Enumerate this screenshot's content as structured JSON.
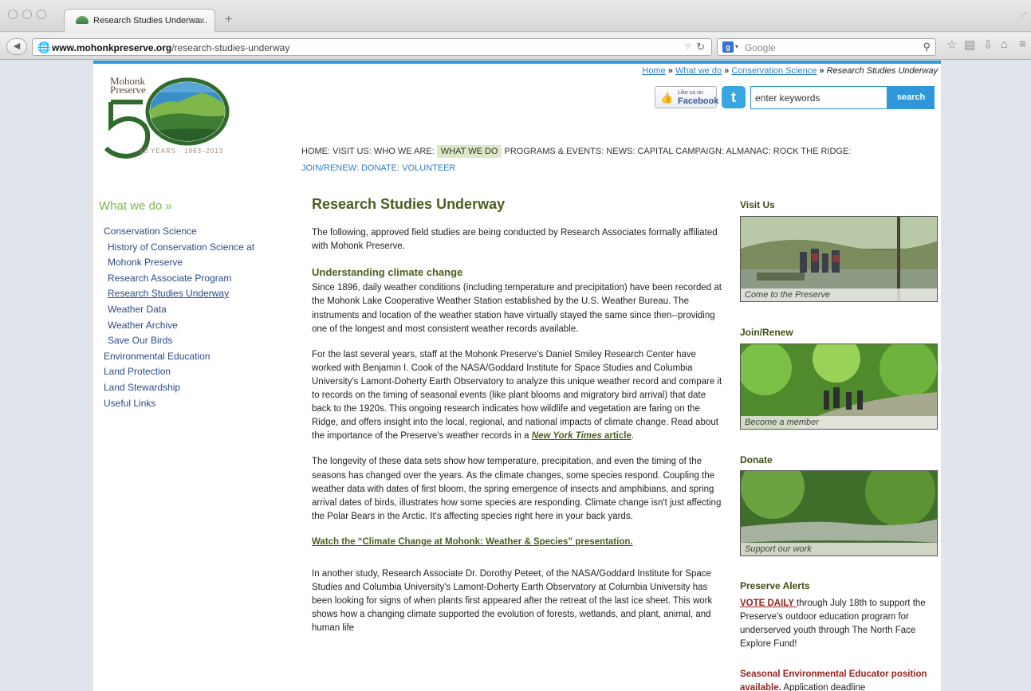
{
  "browser": {
    "tab_title": "Research Studies Underwa...",
    "url_domain": "www.mohonkpreserve.org",
    "url_path": "/research-studies-underway",
    "search_engine": "Google"
  },
  "header": {
    "breadcrumb": {
      "home": "Home",
      "what_we_do": "What we do",
      "conservation_science": "Conservation Science",
      "current": "Research Studies Underway",
      "separator": "»"
    },
    "logo": {
      "name_line1": "Mohonk",
      "name_line2": "Preserve",
      "years": "50 YEARS · 1963–2013"
    },
    "facebook": {
      "small": "Like us on",
      "big": "Facebook"
    },
    "search": {
      "placeholder": "enter keywords",
      "button": "search"
    }
  },
  "mainnav": {
    "items": [
      "HOME",
      "VISIT US",
      "WHO WE ARE",
      "WHAT WE DO",
      "PROGRAMS & EVENTS",
      "NEWS",
      "CAPITAL CAMPAIGN",
      "ALMANAC",
      "ROCK THE RIDGE"
    ],
    "sub_items": [
      "JOIN/RENEW",
      "DONATE",
      "VOLUNTEER"
    ],
    "separator": ":",
    "active": "WHAT WE DO"
  },
  "sidebar": {
    "heading": "What we do »",
    "items": [
      "Conservation Science",
      "History of Conservation Science at Mohonk Preserve",
      "Research Associate Program",
      "Research Studies Underway",
      "Weather Data",
      "Weather Archive",
      "Save Our Birds",
      "Environmental Education",
      "Land Protection",
      "Land Stewardship",
      "Useful Links"
    ]
  },
  "main": {
    "title": "Research Studies Underway",
    "intro": "The following, approved field studies are being conducted by Research Associates formally affiliated with Mohonk Preserve.",
    "section_title": "Understanding climate change",
    "p1": "Since 1896, daily weather conditions (including temperature and precipitation) have been recorded at the Mohonk Lake Cooperative Weather Station established by the U.S. Weather Bureau. The instruments and location of the weather station have virtually stayed the same since then--providing one of the longest and most consistent weather records available.",
    "p2_before": "For the last several years, staff at the Mohonk Preserve's Daniel Smiley Research Center have worked with Benjamin I. Cook of the NASA/Goddard Institute for Space Studies and Columbia University's Lamont-Doherty Earth Observatory to analyze this unique weather record and compare it to records on the timing of seasonal events (like plant blooms and migratory bird arrival) that date back to the 1920s. This ongoing research indicates how wildlife and vegetation are faring on the Ridge, and offers insight into the local, regional, and national impacts of climate change. Read about the importance of the Preserve's weather records in a ",
    "p2_link_italic": "New York Times",
    "p2_link_rest": " article",
    "p2_after": ".",
    "p3": "The longevity of these data sets show how temperature, precipitation, and even the timing of the seasons has changed over the years. As the climate changes, some species respond. Coupling the weather data with dates of first bloom, the spring emergence of insects and amphibians, and spring arrival dates of birds, illustrates how some species are responding. Climate change isn't just affecting the Polar Bears in the Arctic. It's affecting species right here in your back yards.",
    "watch_link": "Watch the “Climate Change at Mohonk: Weather & Species” presentation.",
    "p4": "In another study, Research Associate Dr. Dorothy Peteet, of the NASA/Goddard Institute for Space Studies and Columbia University's Lamont-Doherty Earth Observatory at Columbia University has been looking for signs of when plants first appeared after the retreat of the last ice sheet. This work shows how a changing climate supported the evolution of forests, wetlands, and plant, animal, and human life"
  },
  "rightcol": {
    "visit_heading": "Visit Us",
    "visit_caption": "Come to the Preserve",
    "join_heading": "Join/Renew",
    "join_caption": "Become a member",
    "donate_heading": "Donate",
    "donate_caption": "Support our work",
    "alerts_heading": "Preserve Alerts",
    "alert1_link": "VOTE DAILY ",
    "alert1_text": "through July 18th to support the Preserve's outdoor education program for underserved youth through The North Face Explore Fund!",
    "alert2_head": "Seasonal Environmental Educator position available.",
    "alert2_text": " Application deadline"
  },
  "colors": {
    "accent_blue": "#2f97d9",
    "heading_green": "#4c5e1f",
    "sidebar_green": "#7ab648",
    "alert_red": "#9a1f1a"
  }
}
